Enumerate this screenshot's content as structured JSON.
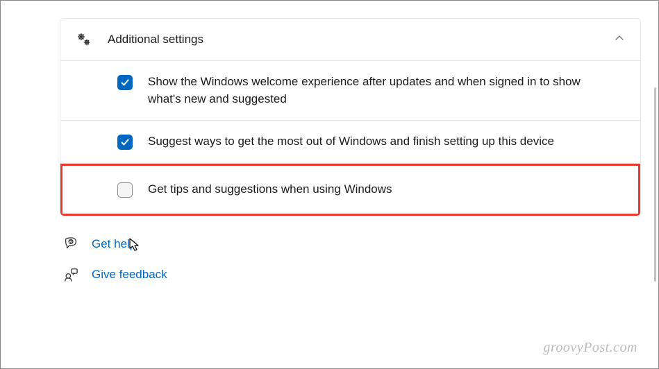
{
  "panel": {
    "title": "Additional settings",
    "expanded": true
  },
  "options": [
    {
      "checked": true,
      "highlighted": false,
      "label": "Show the Windows welcome experience after updates and when signed in to show what's new and suggested"
    },
    {
      "checked": true,
      "highlighted": false,
      "label": "Suggest ways to get the most out of Windows and finish setting up this device"
    },
    {
      "checked": false,
      "highlighted": true,
      "label": "Get tips and suggestions when using Windows"
    }
  ],
  "links": {
    "help": "Get help",
    "feedback": "Give feedback"
  },
  "watermark": "groovyPost.com"
}
